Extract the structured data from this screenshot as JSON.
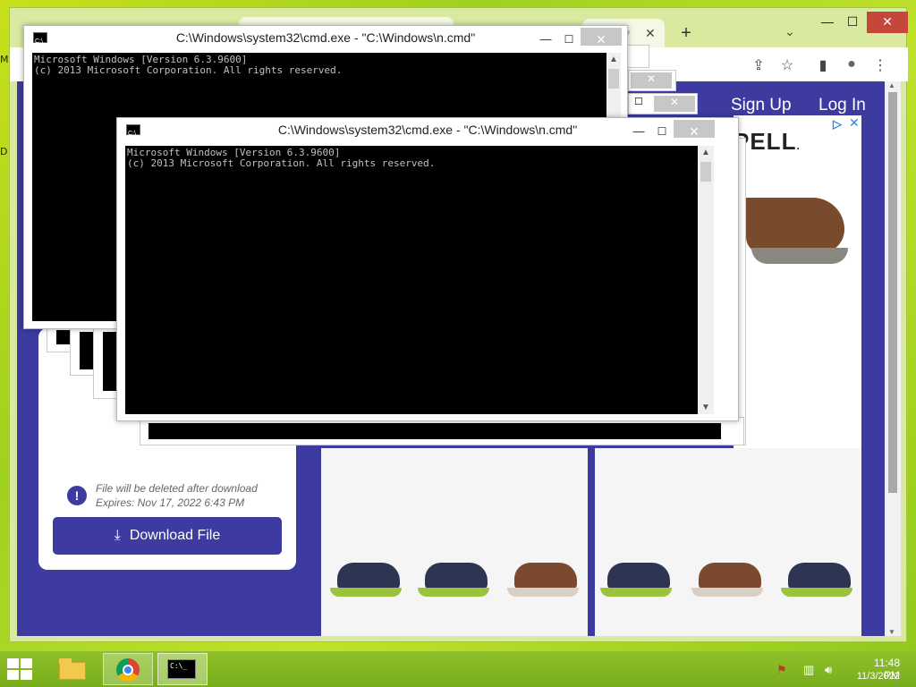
{
  "desktop": {
    "glyph_m": "M",
    "glyph_d": "D"
  },
  "browser": {
    "partial_tab_glyph": "y",
    "new_tab": "+",
    "controls": {
      "minimize": "—",
      "maximize": "☐",
      "close": "✕"
    },
    "toolbar_icons": [
      "share-icon",
      "star-icon",
      "sidebar-icon",
      "profile-icon",
      "menu-icon"
    ]
  },
  "page": {
    "nav": {
      "sign_up": "Sign Up",
      "log_in": "Log In"
    },
    "ad": {
      "brand_partial": "PELL",
      "brand_mark": ".",
      "badge": "▷",
      "close": "✕"
    },
    "file_card": {
      "info_icon": "!",
      "delete_note": "File will be deleted after download",
      "expires": "Expires: Nov 17, 2022 6:43 PM",
      "download_label": "Download File"
    }
  },
  "cmd_windows": [
    {
      "title": "C:\\Windows\\system32\\cmd.exe - \"C:\\Windows\\n.cmd\"",
      "lines": "Microsoft Windows [Version 6.3.9600]\n(c) 2013 Microsoft Corporation. All rights reserved."
    },
    {
      "title": "C:\\Windows\\system32\\cmd.exe - \"C:\\Windows\\n.cmd\"",
      "lines": "Microsoft Windows [Version 6.3.9600]\n(c) 2013 Microsoft Corporation. All rights reserved."
    }
  ],
  "cmd_controls": {
    "minimize": "—",
    "maximize": "☐",
    "close": "✕",
    "scroll_up": "▲",
    "scroll_down": "▼"
  },
  "taskbar": {
    "time": "11:48 PM",
    "date": "11/3/2022",
    "cmd_glyph": "C:\\_",
    "tray_icons": [
      "action-center-icon",
      "network-icon",
      "volume-icon"
    ]
  },
  "colors": {
    "accent": "#3d3aa0",
    "desktop": "#9fd11f",
    "close": "#c5463a"
  }
}
